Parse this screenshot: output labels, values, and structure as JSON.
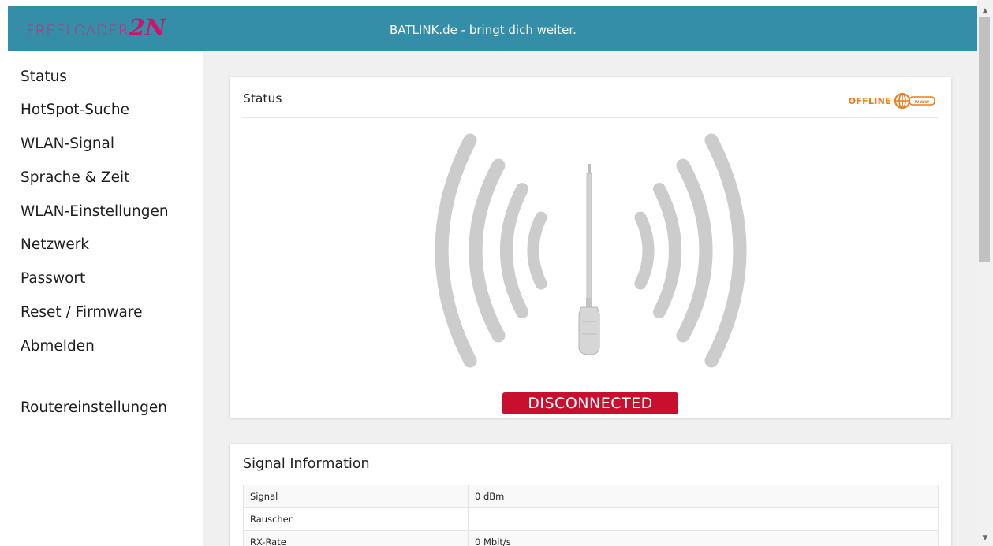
{
  "header": {
    "logo": {
      "text_main": "FREELOADER",
      "text_accent": "2N"
    },
    "tagline": "BATLINK.de - bringt dich weiter."
  },
  "sidebar": {
    "items": [
      {
        "label": "Status"
      },
      {
        "label": "HotSpot-Suche"
      },
      {
        "label": "WLAN-Signal"
      },
      {
        "label": "Sprache & Zeit"
      },
      {
        "label": "WLAN-Einstellungen"
      },
      {
        "label": "Netzwerk"
      },
      {
        "label": "Passwort"
      },
      {
        "label": "Reset / Firmware"
      },
      {
        "label": "Abmelden"
      },
      {
        "label": "Routereinstellungen"
      }
    ]
  },
  "status_card": {
    "title": "Status",
    "offline_label": "OFFLINE",
    "offline_icon_text": "www",
    "offline_color": "#f07a18",
    "state_label": "DISCONNECTED",
    "state_color": "#c8102e"
  },
  "signal_card": {
    "title": "Signal Information",
    "rows": [
      {
        "key": "Signal",
        "value": "0 dBm"
      },
      {
        "key": "Rauschen",
        "value": ""
      },
      {
        "key": "RX-Rate",
        "value": "0 Mbit/s"
      }
    ]
  },
  "colors": {
    "header_bg": "#348ea8",
    "logo": "#c7257a",
    "content_bg": "#f0f0f0"
  },
  "icons": [
    "globe-icon",
    "antenna-icon",
    "signal-waves-icon",
    "scroll-up-arrow-icon",
    "scroll-down-arrow-icon"
  ]
}
